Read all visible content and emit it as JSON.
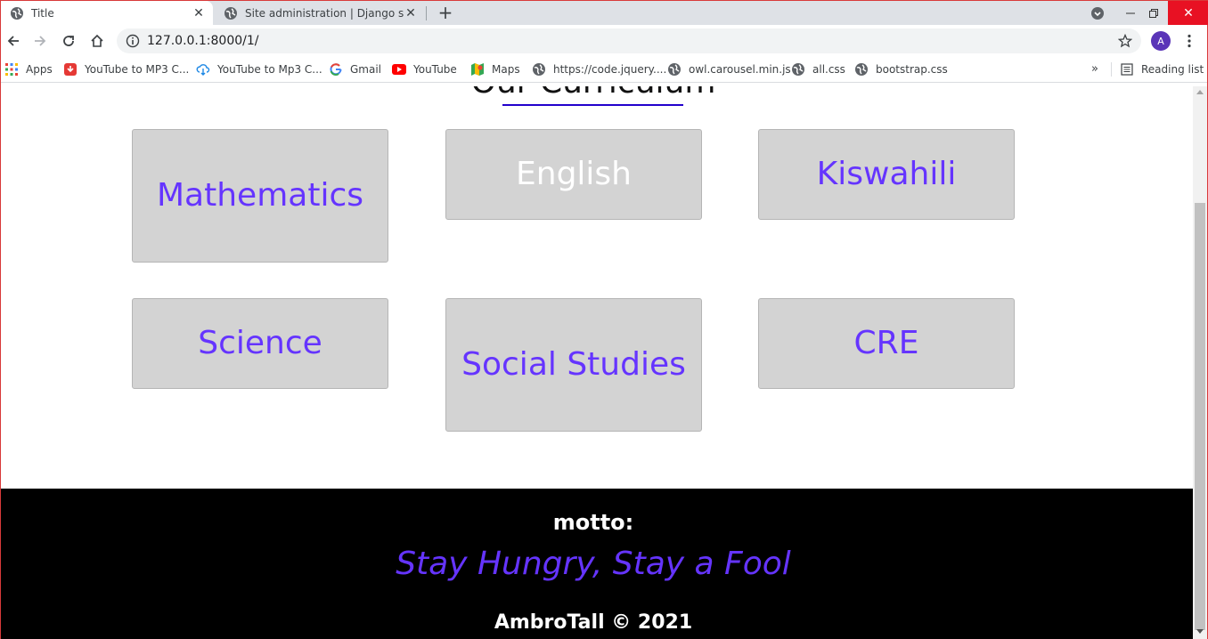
{
  "browser": {
    "tabs": [
      {
        "title": "Title",
        "icon": "globe-icon",
        "active": true
      },
      {
        "title": "Site administration | Django site admin",
        "icon": "globe-icon",
        "active": false
      }
    ],
    "address": "127.0.0.1:8000/1/",
    "profile_initial": "A",
    "profile_color": "#5a35b8",
    "bookmarks": [
      {
        "label": "Apps",
        "icon": "apps-grid-icon"
      },
      {
        "label": "YouTube to MP3 C...",
        "icon": "download-red-icon"
      },
      {
        "label": "YouTube to Mp3 C...",
        "icon": "cloud-download-icon"
      },
      {
        "label": "Gmail",
        "icon": "google-icon"
      },
      {
        "label": "YouTube",
        "icon": "youtube-icon"
      },
      {
        "label": "Maps",
        "icon": "maps-icon"
      },
      {
        "label": "https://code.jquery....",
        "icon": "globe-icon"
      },
      {
        "label": "owl.carousel.min.js",
        "icon": "globe-icon"
      },
      {
        "label": "all.css",
        "icon": "globe-icon"
      },
      {
        "label": "bootstrap.css",
        "icon": "globe-icon"
      }
    ],
    "reading_list": "Reading list"
  },
  "page": {
    "heading": "Our Curriculum",
    "subjects": [
      {
        "name": "Mathematics",
        "color": "#6534ff"
      },
      {
        "name": "English",
        "color": "#ffffff"
      },
      {
        "name": "Kiswahili",
        "color": "#6534ff"
      },
      {
        "name": "Science",
        "color": "#6534ff"
      },
      {
        "name": "Social Studies",
        "color": "#6534ff"
      },
      {
        "name": "CRE",
        "color": "#6534ff"
      }
    ],
    "footer": {
      "motto_label": "motto:",
      "motto": "Stay Hungry, Stay a Fool",
      "copyright": "AmbroTall © 2021"
    }
  }
}
